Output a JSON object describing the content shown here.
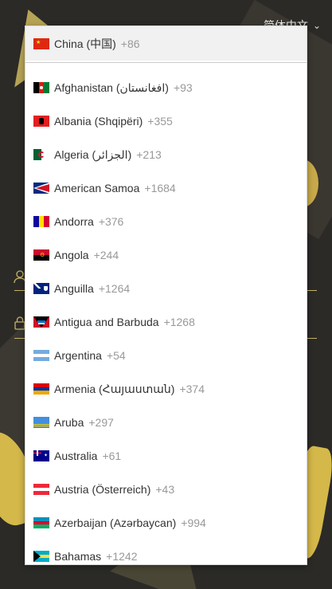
{
  "header": {
    "language_label": "简体中文"
  },
  "preferred": [
    {
      "name": "China (中国)",
      "dial": "+86",
      "flag": "cn"
    }
  ],
  "countries": [
    {
      "name": "Afghanistan (افغانستان‎)",
      "dial": "+93",
      "flag": "af"
    },
    {
      "name": "Albania (Shqipëri)",
      "dial": "+355",
      "flag": "al"
    },
    {
      "name": "Algeria (‫الجزائر‬‎)",
      "dial": "+213",
      "flag": "dz"
    },
    {
      "name": "American Samoa",
      "dial": "+1684",
      "flag": "as"
    },
    {
      "name": "Andorra",
      "dial": "+376",
      "flag": "ad"
    },
    {
      "name": "Angola",
      "dial": "+244",
      "flag": "ao"
    },
    {
      "name": "Anguilla",
      "dial": "+1264",
      "flag": "ai"
    },
    {
      "name": "Antigua and Barbuda",
      "dial": "+1268",
      "flag": "ag"
    },
    {
      "name": "Argentina",
      "dial": "+54",
      "flag": "ar"
    },
    {
      "name": "Armenia (Հայաստան)",
      "dial": "+374",
      "flag": "am"
    },
    {
      "name": "Aruba",
      "dial": "+297",
      "flag": "aw"
    },
    {
      "name": "Australia",
      "dial": "+61",
      "flag": "au"
    },
    {
      "name": "Austria (Österreich)",
      "dial": "+43",
      "flag": "at"
    },
    {
      "name": "Azerbaijan (Azərbaycan)",
      "dial": "+994",
      "flag": "az"
    },
    {
      "name": "Bahamas",
      "dial": "+1242",
      "flag": "bs"
    }
  ],
  "colors": {
    "accent_gold": "#c9b36a",
    "background_dark": "#2b2a27",
    "dial_gray": "#999999"
  }
}
